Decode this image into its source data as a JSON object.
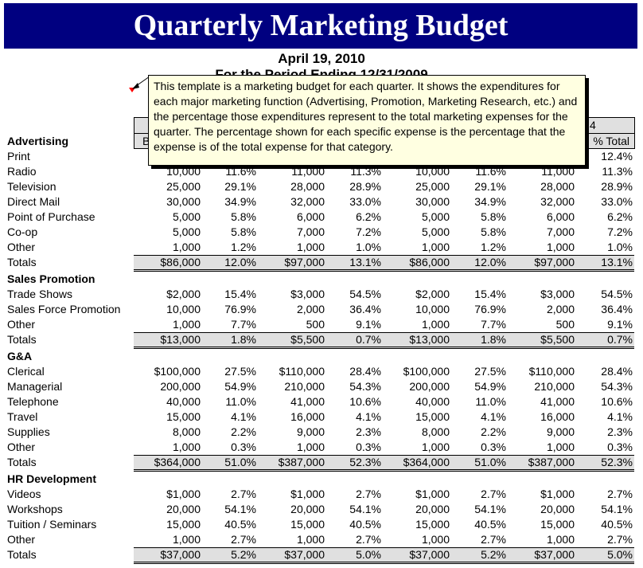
{
  "title": "Quarterly Marketing Budget",
  "date": "April 19, 2010",
  "period": "For the Period Ending 12/31/2009",
  "header": {
    "quarter_visible": "4",
    "budget_partial": "B",
    "pct_total": "% Total"
  },
  "comment": "This template is a marketing budget for each quarter. It shows the expenditures for each major marketing function (Advertising, Promotion, Marketing Research, etc.)  and the percentage those expenditures represent to the total marketing expenses for the quarter. The percentage shown for each specific expense is the percentage that the expense is of the total expense for that category.",
  "sections": [
    {
      "name": "Advertising",
      "rows": [
        {
          "label": "Print",
          "values": [
            null,
            null,
            null,
            null,
            null,
            null,
            null,
            "12.4%"
          ]
        },
        {
          "label": "Radio",
          "values": [
            "10,000",
            "11.6%",
            "11,000",
            "11.3%",
            "10,000",
            "11.6%",
            "11,000",
            "11.3%"
          ]
        },
        {
          "label": "Television",
          "values": [
            "25,000",
            "29.1%",
            "28,000",
            "28.9%",
            "25,000",
            "29.1%",
            "28,000",
            "28.9%"
          ]
        },
        {
          "label": "Direct Mail",
          "values": [
            "30,000",
            "34.9%",
            "32,000",
            "33.0%",
            "30,000",
            "34.9%",
            "32,000",
            "33.0%"
          ]
        },
        {
          "label": "Point of Purchase",
          "values": [
            "5,000",
            "5.8%",
            "6,000",
            "6.2%",
            "5,000",
            "5.8%",
            "6,000",
            "6.2%"
          ]
        },
        {
          "label": "Co-op",
          "values": [
            "5,000",
            "5.8%",
            "7,000",
            "7.2%",
            "5,000",
            "5.8%",
            "7,000",
            "7.2%"
          ]
        },
        {
          "label": "Other",
          "values": [
            "1,000",
            "1.2%",
            "1,000",
            "1.0%",
            "1,000",
            "1.2%",
            "1,000",
            "1.0%"
          ]
        }
      ],
      "totals": {
        "label": "Totals",
        "values": [
          "$86,000",
          "12.0%",
          "$97,000",
          "13.1%",
          "$86,000",
          "12.0%",
          "$97,000",
          "13.1%"
        ]
      }
    },
    {
      "name": "Sales Promotion",
      "rows": [
        {
          "label": "Trade Shows",
          "values": [
            "$2,000",
            "15.4%",
            "$3,000",
            "54.5%",
            "$2,000",
            "15.4%",
            "$3,000",
            "54.5%"
          ]
        },
        {
          "label": "Sales Force Promotion",
          "values": [
            "10,000",
            "76.9%",
            "2,000",
            "36.4%",
            "10,000",
            "76.9%",
            "2,000",
            "36.4%"
          ]
        },
        {
          "label": "Other",
          "values": [
            "1,000",
            "7.7%",
            "500",
            "9.1%",
            "1,000",
            "7.7%",
            "500",
            "9.1%"
          ]
        }
      ],
      "totals": {
        "label": "Totals",
        "values": [
          "$13,000",
          "1.8%",
          "$5,500",
          "0.7%",
          "$13,000",
          "1.8%",
          "$5,500",
          "0.7%"
        ]
      }
    },
    {
      "name": "G&A",
      "rows": [
        {
          "label": "Clerical",
          "values": [
            "$100,000",
            "27.5%",
            "$110,000",
            "28.4%",
            "$100,000",
            "27.5%",
            "$110,000",
            "28.4%"
          ]
        },
        {
          "label": "Managerial",
          "values": [
            "200,000",
            "54.9%",
            "210,000",
            "54.3%",
            "200,000",
            "54.9%",
            "210,000",
            "54.3%"
          ]
        },
        {
          "label": "Telephone",
          "values": [
            "40,000",
            "11.0%",
            "41,000",
            "10.6%",
            "40,000",
            "11.0%",
            "41,000",
            "10.6%"
          ]
        },
        {
          "label": "Travel",
          "values": [
            "15,000",
            "4.1%",
            "16,000",
            "4.1%",
            "15,000",
            "4.1%",
            "16,000",
            "4.1%"
          ]
        },
        {
          "label": "Supplies",
          "values": [
            "8,000",
            "2.2%",
            "9,000",
            "2.3%",
            "8,000",
            "2.2%",
            "9,000",
            "2.3%"
          ]
        },
        {
          "label": "Other",
          "values": [
            "1,000",
            "0.3%",
            "1,000",
            "0.3%",
            "1,000",
            "0.3%",
            "1,000",
            "0.3%"
          ]
        }
      ],
      "totals": {
        "label": "Totals",
        "values": [
          "$364,000",
          "51.0%",
          "$387,000",
          "52.3%",
          "$364,000",
          "51.0%",
          "$387,000",
          "52.3%"
        ]
      }
    },
    {
      "name": "HR Development",
      "rows": [
        {
          "label": "Videos",
          "values": [
            "$1,000",
            "2.7%",
            "$1,000",
            "2.7%",
            "$1,000",
            "2.7%",
            "$1,000",
            "2.7%"
          ]
        },
        {
          "label": "Workshops",
          "values": [
            "20,000",
            "54.1%",
            "20,000",
            "54.1%",
            "20,000",
            "54.1%",
            "20,000",
            "54.1%"
          ]
        },
        {
          "label": "Tuition / Seminars",
          "values": [
            "15,000",
            "40.5%",
            "15,000",
            "40.5%",
            "15,000",
            "40.5%",
            "15,000",
            "40.5%"
          ]
        },
        {
          "label": "Other",
          "values": [
            "1,000",
            "2.7%",
            "1,000",
            "2.7%",
            "1,000",
            "2.7%",
            "1,000",
            "2.7%"
          ]
        }
      ],
      "totals": {
        "label": "Totals",
        "values": [
          "$37,000",
          "5.2%",
          "$37,000",
          "5.0%",
          "$37,000",
          "5.2%",
          "$37,000",
          "5.0%"
        ]
      }
    }
  ],
  "colors": {
    "title_bar": "#000080",
    "comment_bg": "#ffffe1",
    "totals_bg": "#e0e0e0",
    "comment_marker": "#ff0000"
  }
}
